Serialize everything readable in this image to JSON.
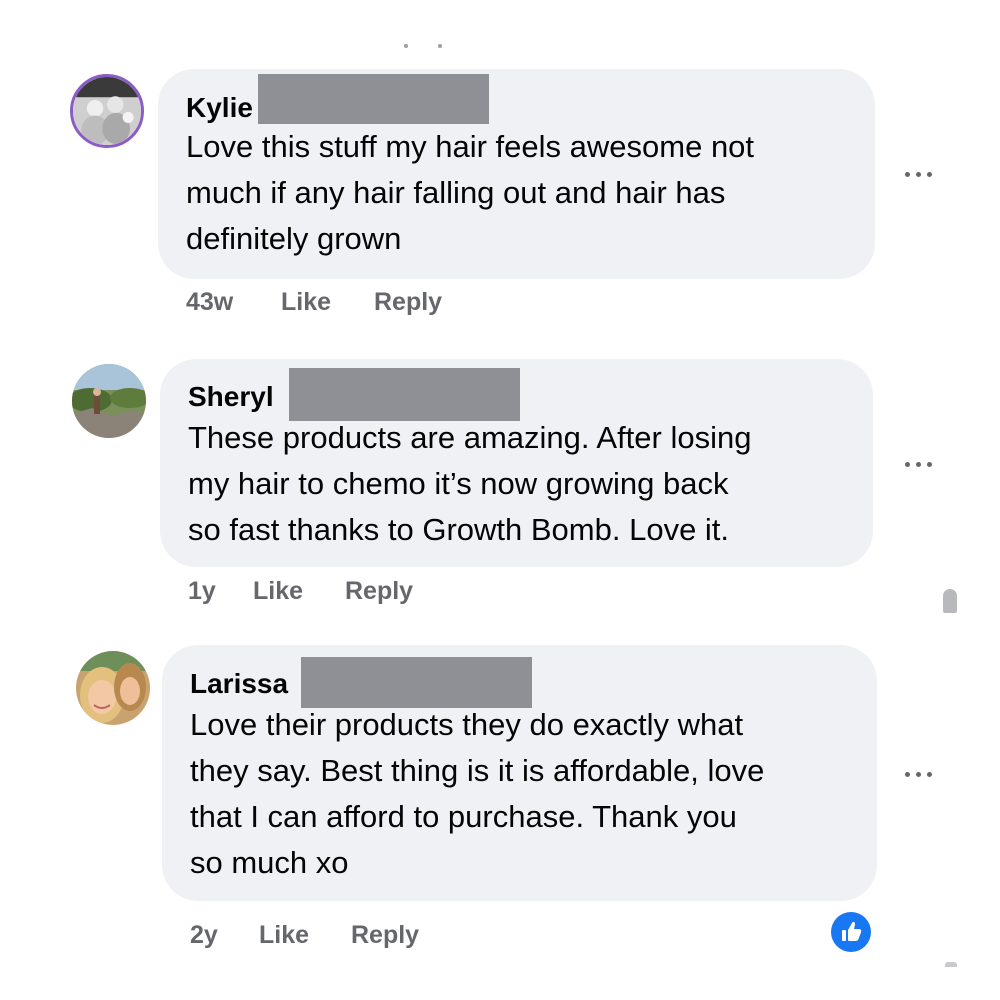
{
  "comments": [
    {
      "author": "Kylie",
      "lines": [
        "Love this stuff my hair feels awesome not",
        "much if any hair falling out and hair has",
        "definitely grown"
      ],
      "time": "43w",
      "like_label": "Like",
      "reply_label": "Reply",
      "avatar_icon": "avatar-photo-family"
    },
    {
      "author": "Sheryl",
      "lines": [
        "These products are amazing. After losing",
        "my hair to chemo it’s now growing back",
        "so fast thanks to Growth Bomb. Love it."
      ],
      "time": "1y",
      "like_label": "Like",
      "reply_label": "Reply",
      "avatar_icon": "avatar-photo-landscape"
    },
    {
      "author": "Larissa",
      "lines": [
        "Love their products they do exactly what",
        "they say. Best thing is it is affordable, love",
        "that I can afford to purchase. Thank you",
        "so much xo"
      ],
      "time": "2y",
      "like_label": "Like",
      "reply_label": "Reply",
      "avatar_icon": "avatar-photo-selfie"
    }
  ],
  "more_icon": "more-options-icon",
  "reaction_icon": "like-reaction-icon",
  "colors": {
    "bubble": "#f0f1f4",
    "meta_text": "#65676b",
    "redaction": "#8f9095",
    "like_blue": "#1877f2"
  }
}
